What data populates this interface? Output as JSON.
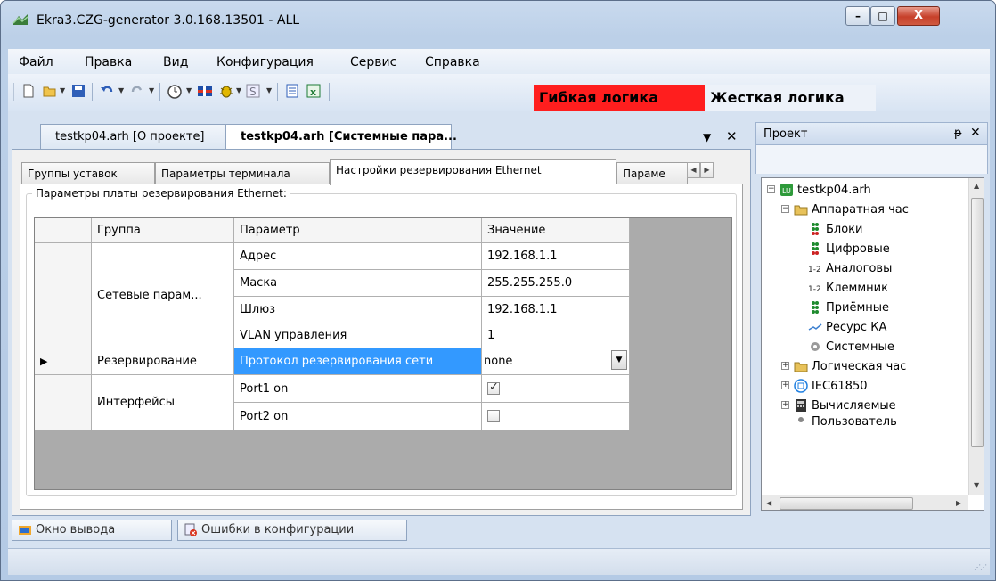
{
  "window": {
    "title": "Ekra3.CZG-generator 3.0.168.13501 - ALL"
  },
  "menu": [
    "Файл",
    "Правка",
    "Вид",
    "Конфигурация",
    "Сервис",
    "Справка"
  ],
  "logic_tabs": {
    "flexible": "Гибкая логика",
    "hard": "Жесткая логика",
    "flexible_color": "#ff1e1e"
  },
  "document_tabs": [
    {
      "label": "testkp04.arh [О проекте]",
      "active": false
    },
    {
      "label": "testkp04.arh [Системные пара...",
      "active": true
    }
  ],
  "sub_tabs": [
    {
      "label": "Группы уставок",
      "active": false
    },
    {
      "label": "Параметры терминала",
      "active": false
    },
    {
      "label": "Настройки резервирования Ethernet",
      "active": true
    },
    {
      "label": "Параме",
      "active": false
    }
  ],
  "group_caption": "Параметры платы резервирования Ethernet:",
  "grid": {
    "headers": [
      "Группа",
      "Параметр",
      "Значение"
    ],
    "groups": [
      "Сетевые парам...",
      "Резервирование",
      "Интерфейсы"
    ],
    "rows": [
      {
        "param": "Адрес",
        "value": "192.168.1.1"
      },
      {
        "param": "Маска",
        "value": "255.255.255.0"
      },
      {
        "param": "Шлюз",
        "value": "192.168.1.1"
      },
      {
        "param": "VLAN управления",
        "value": "1"
      },
      {
        "param": "Протокол резервирования сети",
        "value": "none"
      },
      {
        "param": "Port1 on",
        "checked": true
      },
      {
        "param": "Port2 on",
        "checked": false
      }
    ]
  },
  "project_panel": {
    "title": "Проект",
    "tree": [
      {
        "label": "testkp04.arh",
        "icon": "project-icon"
      },
      {
        "label": "Аппаратная час",
        "icon": "folder-icon"
      },
      {
        "label": "Блоки",
        "icon": "blocks-icon"
      },
      {
        "label": "Цифровые",
        "icon": "blocks-icon"
      },
      {
        "label": "Аналоговы",
        "icon": "analog-icon"
      },
      {
        "label": "Клеммник",
        "icon": "analog-icon"
      },
      {
        "label": "Приёмные",
        "icon": "blocks-icon"
      },
      {
        "label": "Ресурс КА",
        "icon": "resource-icon"
      },
      {
        "label": "Системные",
        "icon": "gear-icon"
      },
      {
        "label": "Логическая час",
        "icon": "folder-icon"
      },
      {
        "label": "IEC61850",
        "icon": "iec-icon"
      },
      {
        "label": "Вычисляемые",
        "icon": "calculator-icon"
      },
      {
        "label": "Пользователь",
        "icon": "users-icon"
      }
    ]
  },
  "bottom_tabs": [
    "Окно вывода",
    "Ошибки в конфигурации"
  ]
}
